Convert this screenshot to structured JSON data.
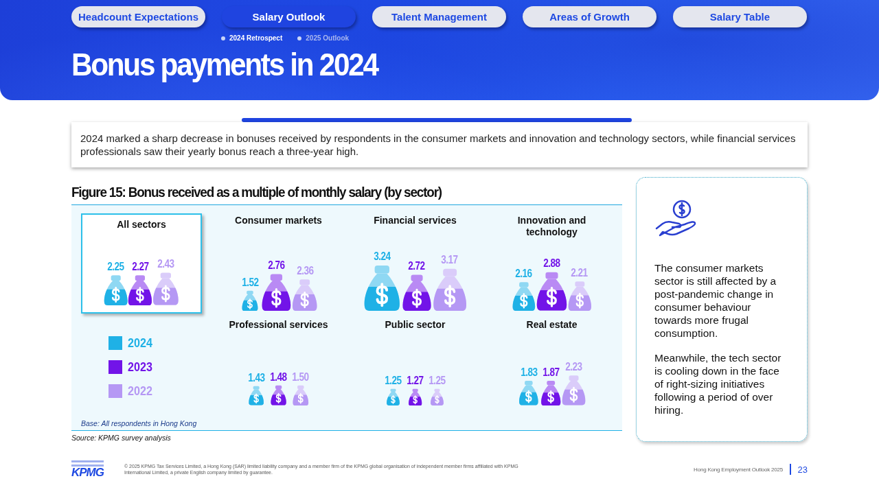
{
  "nav_tabs": [
    {
      "label": "Headcount Expectations",
      "selected": false
    },
    {
      "label": "Salary Outlook",
      "selected": true
    },
    {
      "label": "Talent Management",
      "selected": false
    },
    {
      "label": "Areas of Growth",
      "selected": false
    },
    {
      "label": "Salary Table",
      "selected": false
    }
  ],
  "sub_tabs": [
    {
      "label": "2024 Retrospect",
      "selected": true
    },
    {
      "label": "2025 Outlook",
      "selected": false
    }
  ],
  "title": "Bonus payments in 2024",
  "intro": "2024 marked a sharp decrease in bonuses received by respondents in the consumer markets and innovation and technology sectors, while financial services professionals saw their yearly bonus reach a three-year high.",
  "figure_title": "Figure 15: Bonus received as a multiple of monthly salary (by sector)",
  "legend": [
    {
      "label": "2024",
      "color": "#1fb1e6"
    },
    {
      "label": "2023",
      "color": "#7214e8"
    },
    {
      "label": "2022",
      "color": "#b598f4"
    }
  ],
  "sectors": [
    {
      "name": "All sectors",
      "selected": true,
      "values": [
        "2.25",
        "2.27",
        "2.43"
      ]
    },
    {
      "name": "Consumer markets",
      "selected": false,
      "values": [
        "1.52",
        "2.76",
        "2.36"
      ]
    },
    {
      "name": "Financial services",
      "selected": false,
      "values": [
        "3.24",
        "2.72",
        "3.17"
      ]
    },
    {
      "name": "Innovation and technology",
      "selected": false,
      "values": [
        "2.16",
        "2.88",
        "2.21"
      ]
    },
    {
      "name": "Professional services",
      "selected": false,
      "values": [
        "1.43",
        "1.48",
        "1.50"
      ]
    },
    {
      "name": "Public sector",
      "selected": false,
      "values": [
        "1.25",
        "1.27",
        "1.25"
      ]
    },
    {
      "name": "Real estate",
      "selected": false,
      "values": [
        "1.83",
        "1.87",
        "2.23"
      ]
    }
  ],
  "base_note": "Base: All respondents in Hong Kong",
  "source": "Source: KPMG survey analysis",
  "side_card": {
    "paragraphs": [
      "The consumer markets sector is still affected by a post-pandemic change in consumer behaviour towards more frugal consumption.",
      "Meanwhile, the tech sector is cooling down in the face of right-sizing initiatives following a period of over hiring."
    ]
  },
  "footer": {
    "logo": "KPMG",
    "copyright": "© 2025 KPMG Tax Services Limited, a Hong Kong (SAR) limited liability company and a member firm of the KPMG global organisation of independent member firms affiliated with KPMG International Limited, a private English company limited by guarantee.",
    "publication": "Hong Kong Employment Outlook 2025",
    "page": "23"
  }
}
